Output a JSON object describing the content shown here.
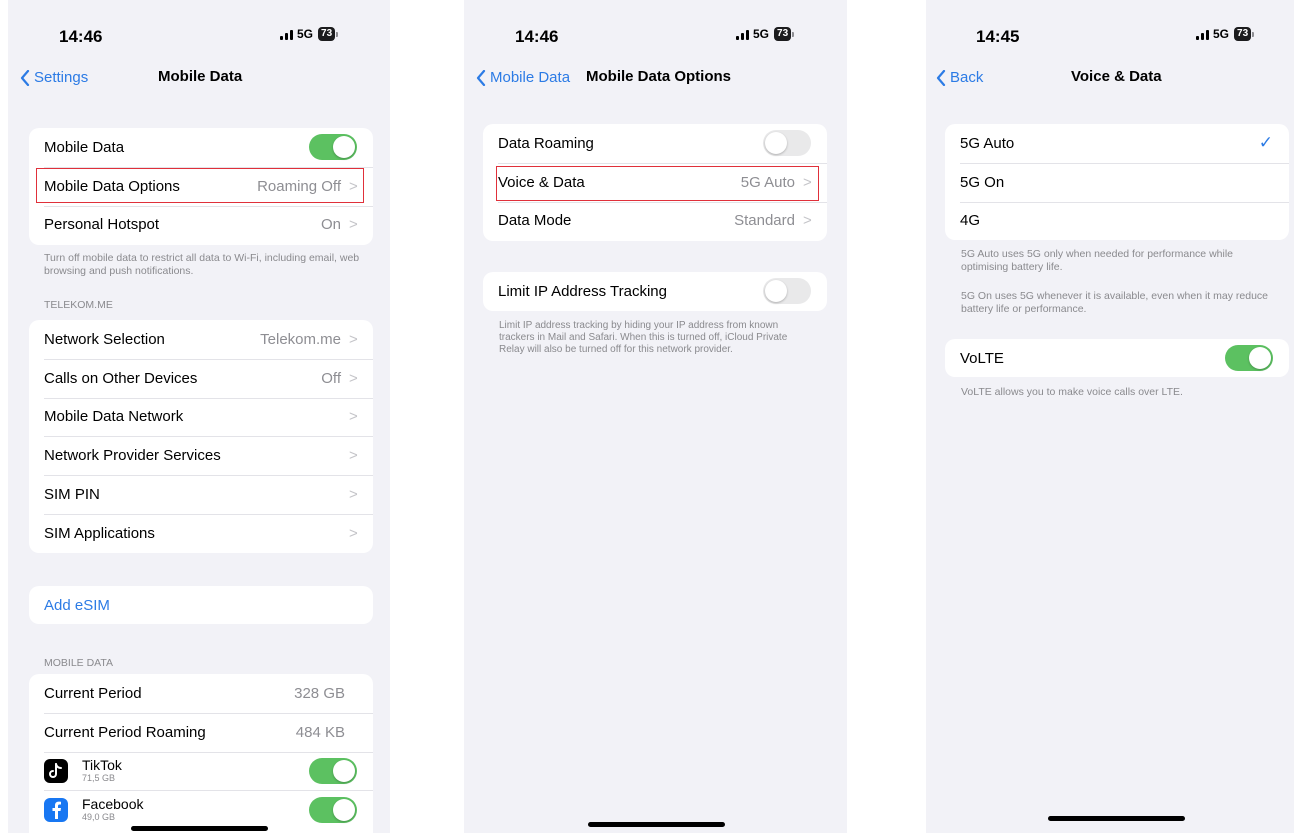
{
  "screens": [
    {
      "status": {
        "time": "14:46",
        "network": "5G",
        "battery": "73"
      },
      "nav": {
        "back_label": "Settings",
        "title": "Mobile Data"
      },
      "group1": [
        {
          "label": "Mobile Data",
          "toggle": "on"
        },
        {
          "label": "Mobile Data Options",
          "value": "Roaming Off",
          "highlighted": true
        },
        {
          "label": "Personal Hotspot",
          "value": "On"
        }
      ],
      "group1_footer": "Turn off mobile data to restrict all data to Wi-Fi, including email, web browsing and push notifications.",
      "carrier_header": "TELEKOM.ME",
      "group2": [
        {
          "label": "Network Selection",
          "value": "Telekom.me"
        },
        {
          "label": "Calls on Other Devices",
          "value": "Off"
        },
        {
          "label": "Mobile Data Network",
          "value": ""
        },
        {
          "label": "Network Provider Services",
          "value": ""
        },
        {
          "label": "SIM PIN",
          "value": ""
        },
        {
          "label": "SIM Applications",
          "value": ""
        }
      ],
      "add_esim": "Add eSIM",
      "usage_header": "MOBILE DATA",
      "usage": [
        {
          "label": "Current Period",
          "value": "328 GB"
        },
        {
          "label": "Current Period Roaming",
          "value": "484 KB"
        }
      ],
      "apps": [
        {
          "name": "TikTok",
          "size": "71,5 GB",
          "icon": "tiktok-icon",
          "toggle": "on"
        },
        {
          "name": "Facebook",
          "size": "49,0 GB",
          "icon": "facebook-icon",
          "toggle": "on"
        }
      ]
    },
    {
      "status": {
        "time": "14:46",
        "network": "5G",
        "battery": "73"
      },
      "nav": {
        "back_label": "Mobile Data",
        "title": "Mobile Data Options"
      },
      "group1": [
        {
          "label": "Data Roaming",
          "toggle": "off"
        },
        {
          "label": "Voice & Data",
          "value": "5G Auto",
          "highlighted": true
        },
        {
          "label": "Data Mode",
          "value": "Standard"
        }
      ],
      "group2": [
        {
          "label": "Limit IP Address Tracking",
          "toggle": "off"
        }
      ],
      "group2_footer": "Limit IP address tracking by hiding your IP address from known trackers in Mail and Safari. When this is turned off, iCloud Private Relay will also be turned off for this network provider."
    },
    {
      "status": {
        "time": "14:45",
        "network": "5G",
        "battery": "73"
      },
      "nav": {
        "back_label": "Back",
        "title": "Voice & Data"
      },
      "options": [
        {
          "label": "5G Auto",
          "selected": true
        },
        {
          "label": "5G On",
          "selected": false
        },
        {
          "label": "4G",
          "selected": false
        }
      ],
      "options_footer_1": "5G Auto uses 5G only when needed for performance while optimising battery life.",
      "options_footer_2": "5G On uses 5G whenever it is available, even when it may reduce battery life or performance.",
      "volte": {
        "label": "VoLTE",
        "toggle": "on"
      },
      "volte_footer": "VoLTE allows you to make voice calls over LTE.",
      "checkmark": "✓"
    }
  ],
  "glyphs": {
    "chevron": ">"
  },
  "colors": {
    "accent": "#2c7be5",
    "toggle_on": "#5cc161",
    "highlight_box": "#e0303a",
    "background": "#f2f2f7"
  }
}
